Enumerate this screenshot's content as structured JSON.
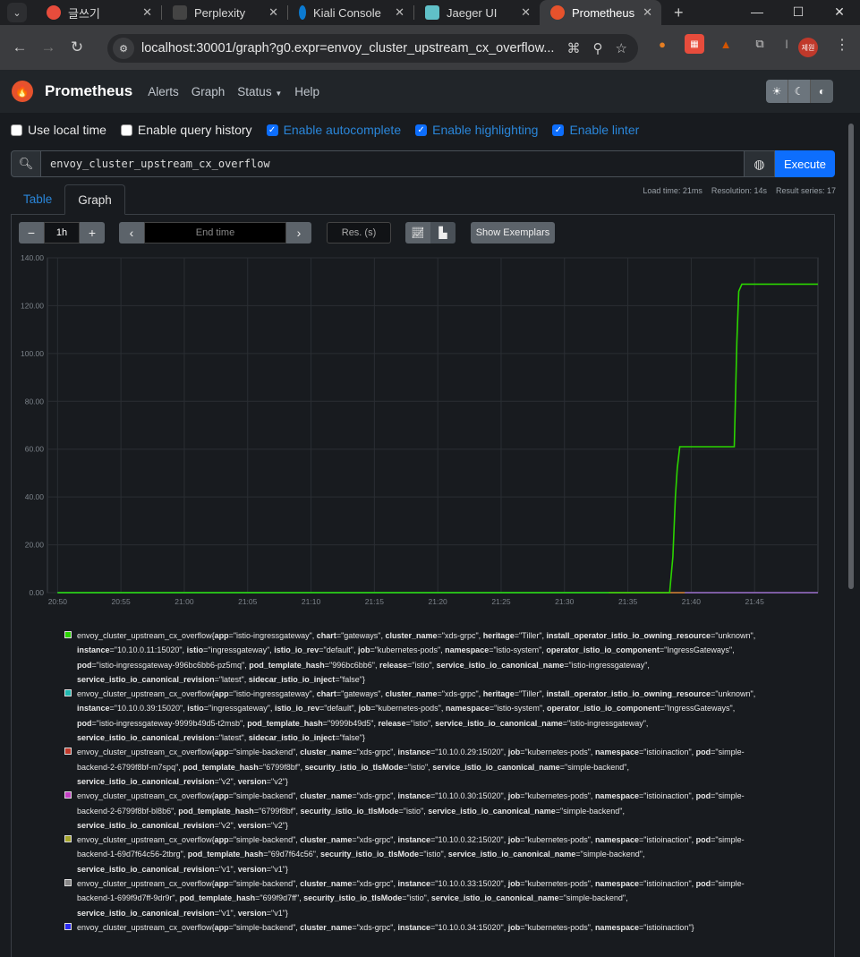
{
  "browser": {
    "tabs": [
      {
        "label": "글쓰기",
        "favicon_color": "#e74c3c"
      },
      {
        "label": "Perplexity",
        "favicon_color": "#444444"
      },
      {
        "label": "Kiali Console",
        "favicon_color": "#0b7ad1"
      },
      {
        "label": "Jaeger UI",
        "favicon_color": "#60c0c8"
      },
      {
        "label": "Prometheus",
        "favicon_color": "#e6522c"
      }
    ],
    "url": "localhost:30001/graph?g0.expr=envoy_cluster_upstream_cx_overflow...",
    "profile_label": "제원"
  },
  "app": {
    "brand": "Prometheus",
    "nav": [
      "Alerts",
      "Graph",
      "Status",
      "Help"
    ],
    "options": [
      {
        "label": "Use local time",
        "checked": false
      },
      {
        "label": "Enable query history",
        "checked": false
      },
      {
        "label": "Enable autocomplete",
        "checked": true
      },
      {
        "label": "Enable highlighting",
        "checked": true
      },
      {
        "label": "Enable linter",
        "checked": true
      }
    ],
    "query": "envoy_cluster_upstream_cx_overflow",
    "execute_label": "Execute",
    "stats": {
      "load_time": "Load time: 21ms",
      "resolution": "Resolution: 14s",
      "result_series": "Result series: 17"
    },
    "tabs": [
      "Table",
      "Graph"
    ],
    "controls": {
      "range": "1h",
      "end_time_placeholder": "End time",
      "res_placeholder": "Res. (s)",
      "show_exemplars": "Show Exemplars"
    }
  },
  "chart_data": {
    "type": "line",
    "ylim": [
      0,
      140
    ],
    "y_ticks": [
      "0.00",
      "20.00",
      "40.00",
      "60.00",
      "80.00",
      "100.00",
      "120.00",
      "140.00"
    ],
    "x_ticks": [
      "20:50",
      "20:55",
      "21:00",
      "21:05",
      "21:10",
      "21:15",
      "21:20",
      "21:25",
      "21:30",
      "21:35",
      "21:40",
      "21:45"
    ],
    "x_range_minutes": [
      -0.8,
      60
    ],
    "series": [
      {
        "color": "#2bd400",
        "x": [
          0,
          48.3,
          48.55,
          48.75,
          48.9,
          49.1,
          53.4,
          53.6,
          53.75,
          54.0,
          60
        ],
        "y": [
          0,
          0,
          15,
          40,
          52,
          61,
          61,
          105,
          126,
          129,
          129
        ]
      },
      {
        "color": "#20b8b0",
        "x": [
          0,
          60
        ],
        "y": [
          0,
          0
        ]
      },
      {
        "color": "#d96a1f",
        "x": [
          43.5,
          49.5
        ],
        "y": [
          0,
          0
        ]
      },
      {
        "color": "#9b59b6",
        "x": [
          49.5,
          60
        ],
        "y": [
          0,
          0
        ]
      }
    ]
  },
  "legend": [
    {
      "color": "#2bd400",
      "metric": "envoy_cluster_upstream_cx_overflow",
      "labels": [
        [
          "app",
          "istio-ingressgateway"
        ],
        [
          "chart",
          "gateways"
        ],
        [
          "cluster_name",
          "xds-grpc"
        ],
        [
          "heritage",
          "Tiller"
        ],
        [
          "install_operator_istio_io_owning_resource",
          "unknown"
        ],
        [
          "instance",
          "10.10.0.11:15020"
        ],
        [
          "istio",
          "ingressgateway"
        ],
        [
          "istio_io_rev",
          "default"
        ],
        [
          "job",
          "kubernetes-pods"
        ],
        [
          "namespace",
          "istio-system"
        ],
        [
          "operator_istio_io_component",
          "IngressGateways"
        ],
        [
          "pod",
          "istio-ingressgateway-996bc6bb6-pz5mq"
        ],
        [
          "pod_template_hash",
          "996bc6bb6"
        ],
        [
          "release",
          "istio"
        ],
        [
          "service_istio_io_canonical_name",
          "istio-ingressgateway"
        ],
        [
          "service_istio_io_canonical_revision",
          "latest"
        ],
        [
          "sidecar_istio_io_inject",
          "false"
        ]
      ]
    },
    {
      "color": "#20b8b0",
      "metric": "envoy_cluster_upstream_cx_overflow",
      "labels": [
        [
          "app",
          "istio-ingressgateway"
        ],
        [
          "chart",
          "gateways"
        ],
        [
          "cluster_name",
          "xds-grpc"
        ],
        [
          "heritage",
          "Tiller"
        ],
        [
          "install_operator_istio_io_owning_resource",
          "unknown"
        ],
        [
          "instance",
          "10.10.0.39:15020"
        ],
        [
          "istio",
          "ingressgateway"
        ],
        [
          "istio_io_rev",
          "default"
        ],
        [
          "job",
          "kubernetes-pods"
        ],
        [
          "namespace",
          "istio-system"
        ],
        [
          "operator_istio_io_component",
          "IngressGateways"
        ],
        [
          "pod",
          "istio-ingressgateway-9999b49d5-t2msb"
        ],
        [
          "pod_template_hash",
          "9999b49d5"
        ],
        [
          "release",
          "istio"
        ],
        [
          "service_istio_io_canonical_name",
          "istio-ingressgateway"
        ],
        [
          "service_istio_io_canonical_revision",
          "latest"
        ],
        [
          "sidecar_istio_io_inject",
          "false"
        ]
      ]
    },
    {
      "color": "#c0392b",
      "metric": "envoy_cluster_upstream_cx_overflow",
      "labels": [
        [
          "app",
          "simple-backend"
        ],
        [
          "cluster_name",
          "xds-grpc"
        ],
        [
          "instance",
          "10.10.0.29:15020"
        ],
        [
          "job",
          "kubernetes-pods"
        ],
        [
          "namespace",
          "istioinaction"
        ],
        [
          "pod",
          "simple-backend-2-6799f8bf-m7spq"
        ],
        [
          "pod_template_hash",
          "6799f8bf"
        ],
        [
          "security_istio_io_tlsMode",
          "istio"
        ],
        [
          "service_istio_io_canonical_name",
          "simple-backend"
        ],
        [
          "service_istio_io_canonical_revision",
          "v2"
        ],
        [
          "version",
          "v2"
        ]
      ]
    },
    {
      "color": "#c33fc3",
      "metric": "envoy_cluster_upstream_cx_overflow",
      "labels": [
        [
          "app",
          "simple-backend"
        ],
        [
          "cluster_name",
          "xds-grpc"
        ],
        [
          "instance",
          "10.10.0.30:15020"
        ],
        [
          "job",
          "kubernetes-pods"
        ],
        [
          "namespace",
          "istioinaction"
        ],
        [
          "pod",
          "simple-backend-2-6799f8bf-bl8b6"
        ],
        [
          "pod_template_hash",
          "6799f8bf"
        ],
        [
          "security_istio_io_tlsMode",
          "istio"
        ],
        [
          "service_istio_io_canonical_name",
          "simple-backend"
        ],
        [
          "service_istio_io_canonical_revision",
          "v2"
        ],
        [
          "version",
          "v2"
        ]
      ]
    },
    {
      "color": "#a5a52a",
      "metric": "envoy_cluster_upstream_cx_overflow",
      "labels": [
        [
          "app",
          "simple-backend"
        ],
        [
          "cluster_name",
          "xds-grpc"
        ],
        [
          "instance",
          "10.10.0.32:15020"
        ],
        [
          "job",
          "kubernetes-pods"
        ],
        [
          "namespace",
          "istioinaction"
        ],
        [
          "pod",
          "simple-backend-1-69d7f64c56-2tbrg"
        ],
        [
          "pod_template_hash",
          "69d7f64c56"
        ],
        [
          "security_istio_io_tlsMode",
          "istio"
        ],
        [
          "service_istio_io_canonical_name",
          "simple-backend"
        ],
        [
          "service_istio_io_canonical_revision",
          "v1"
        ],
        [
          "version",
          "v1"
        ]
      ]
    },
    {
      "color": "#888888",
      "metric": "envoy_cluster_upstream_cx_overflow",
      "labels": [
        [
          "app",
          "simple-backend"
        ],
        [
          "cluster_name",
          "xds-grpc"
        ],
        [
          "instance",
          "10.10.0.33:15020"
        ],
        [
          "job",
          "kubernetes-pods"
        ],
        [
          "namespace",
          "istioinaction"
        ],
        [
          "pod",
          "simple-backend-1-699f9d7ff-9dr9r"
        ],
        [
          "pod_template_hash",
          "699f9d7ff"
        ],
        [
          "security_istio_io_tlsMode",
          "istio"
        ],
        [
          "service_istio_io_canonical_name",
          "simple-backend"
        ],
        [
          "service_istio_io_canonical_revision",
          "v1"
        ],
        [
          "version",
          "v1"
        ]
      ]
    },
    {
      "color": "#2a2af0",
      "metric": "envoy_cluster_upstream_cx_overflow",
      "labels": [
        [
          "app",
          "simple-backend"
        ],
        [
          "cluster_name",
          "xds-grpc"
        ],
        [
          "instance",
          "10.10.0.34:15020"
        ],
        [
          "job",
          "kubernetes-pods"
        ],
        [
          "namespace",
          "istioinaction"
        ]
      ]
    }
  ]
}
